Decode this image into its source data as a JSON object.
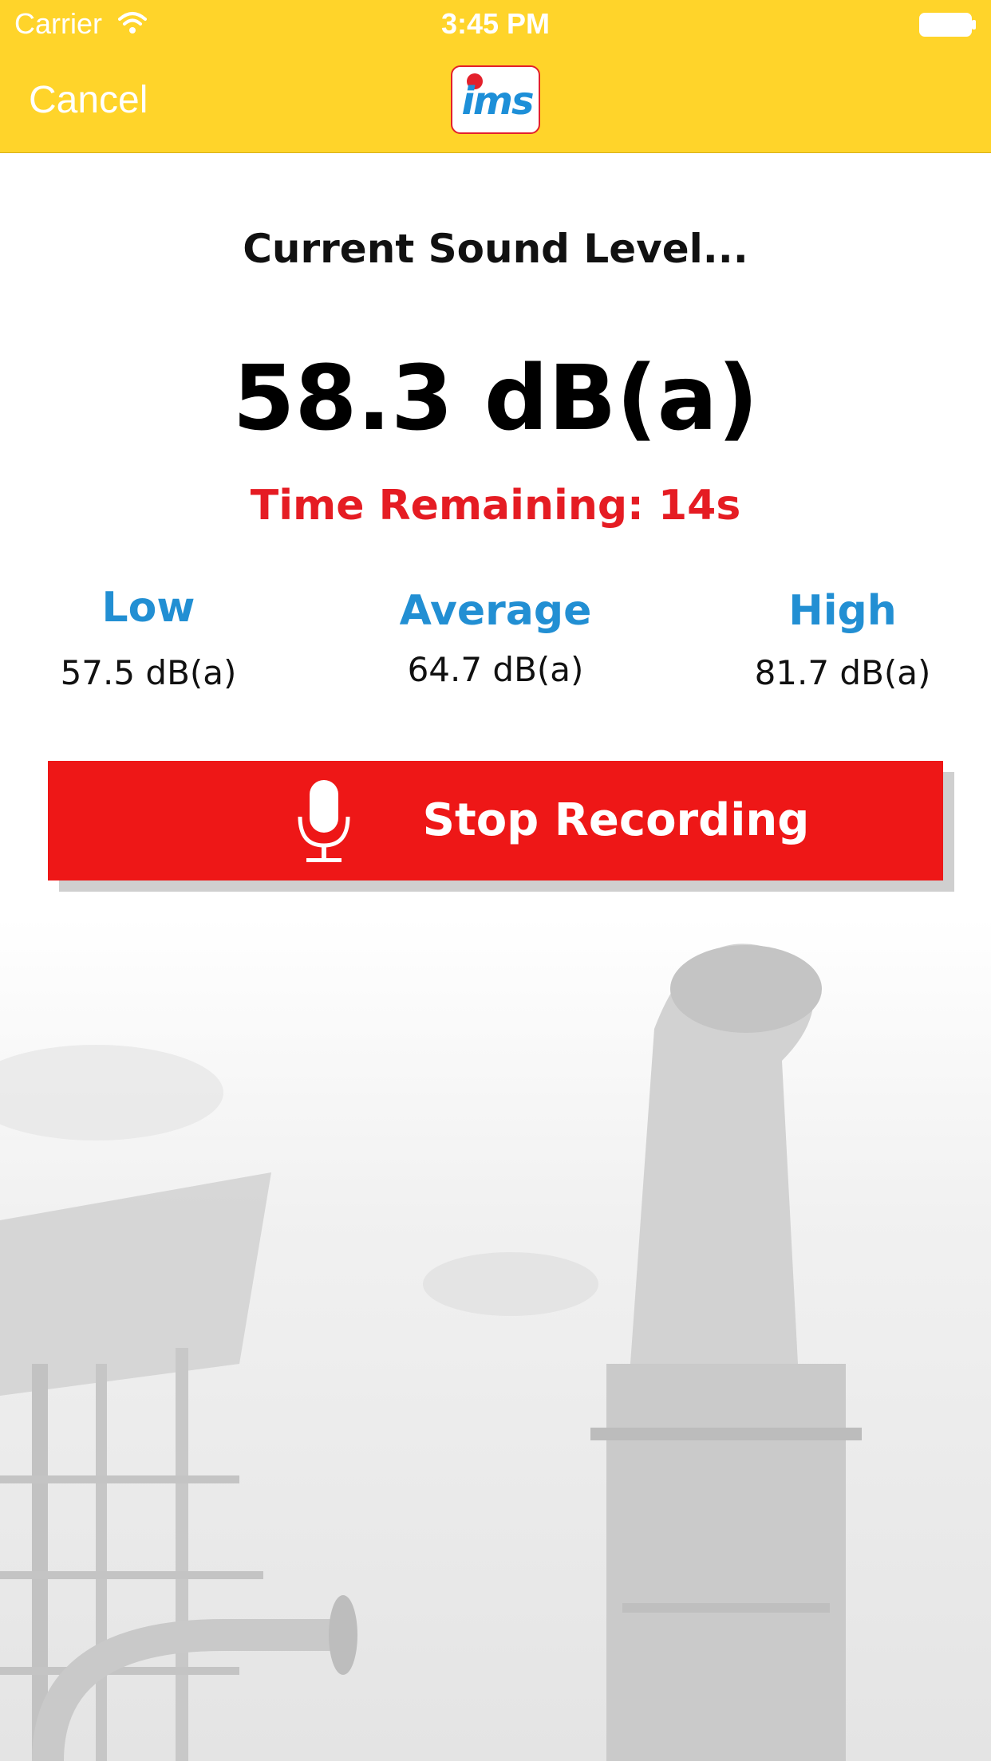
{
  "status_bar": {
    "carrier": "Carrier",
    "time": "3:45 PM",
    "wifi_icon": "wifi-icon",
    "battery_icon": "battery-icon"
  },
  "nav": {
    "cancel_label": "Cancel",
    "logo_text": "ims",
    "logo_icon": "ims-logo"
  },
  "main": {
    "title": "Current Sound Level...",
    "current_level": "58.3 dB(a)",
    "time_remaining": "Time Remaining: 14s",
    "stats": {
      "low": {
        "label": "Low",
        "value": "57.5 dB(a)"
      },
      "average": {
        "label": "Average",
        "value": "64.7 dB(a)"
      },
      "high": {
        "label": "High",
        "value": "81.7 dB(a)"
      }
    },
    "stop_button": {
      "label": "Stop Recording",
      "icon": "microphone-icon"
    }
  },
  "colors": {
    "header_yellow": "#ffd42a",
    "alert_red": "#e51c23",
    "button_red": "#ee1717",
    "stat_blue": "#228fd3"
  }
}
